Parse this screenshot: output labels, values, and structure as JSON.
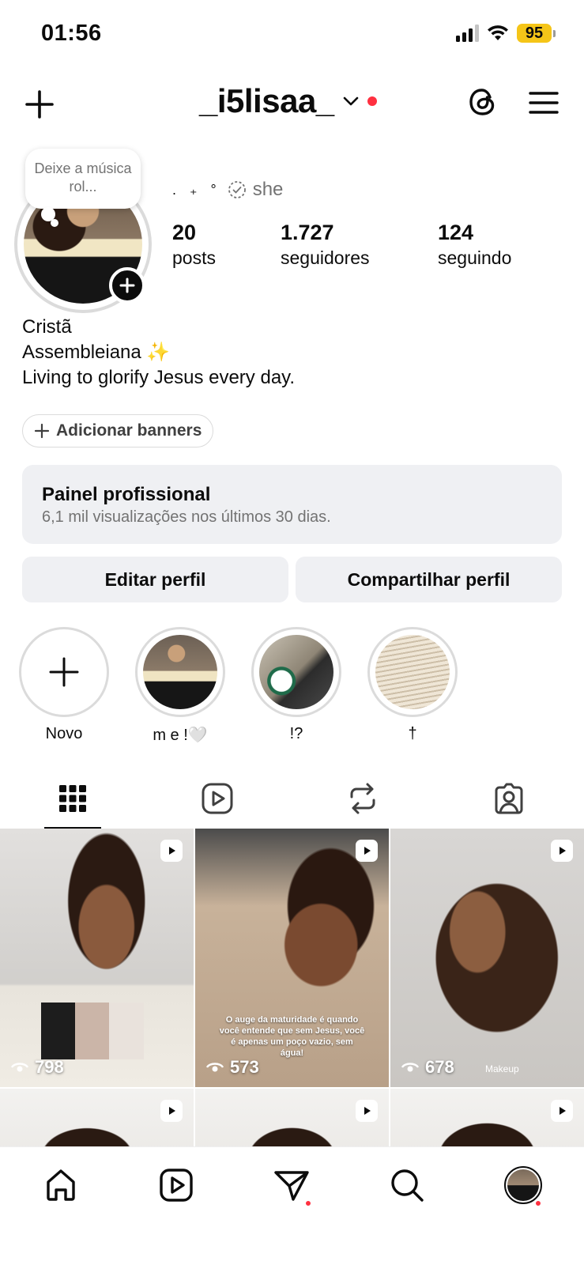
{
  "status_bar": {
    "time": "01:56",
    "battery": "95"
  },
  "header": {
    "username": "_i5lisaa_"
  },
  "profile": {
    "note": "Deixe a música rol...",
    "pronoun_prefix": ". ₊ °",
    "pronouns": "she",
    "stats": [
      {
        "value": "20",
        "label": "posts"
      },
      {
        "value": "1.727",
        "label": "seguidores"
      },
      {
        "value": "124",
        "label": "seguindo"
      }
    ],
    "bio": [
      "Cristã",
      "Assembleiana ✨",
      "Living to glorify Jesus every day."
    ],
    "add_banners": "Adicionar banners"
  },
  "professional_panel": {
    "title": "Painel profissional",
    "subtitle": "6,1 mil visualizações nos últimos 30 dias."
  },
  "actions": {
    "edit": "Editar perfil",
    "share": "Compartilhar perfil"
  },
  "highlights": [
    {
      "label": "Novo"
    },
    {
      "label": "m e !🤍"
    },
    {
      "label": "!?"
    },
    {
      "label": "†"
    }
  ],
  "posts": [
    {
      "views": "798",
      "caption": "",
      "tag": ""
    },
    {
      "views": "573",
      "caption": "O auge da maturidade é quando você entende que sem Jesus, você é apenas um poço vazio, sem água!",
      "tag": ""
    },
    {
      "views": "678",
      "caption": "",
      "tag": "Makeup"
    }
  ],
  "colors": {
    "notification": "#ff3040",
    "battery": "#f5c518",
    "panel": "#eff0f3"
  }
}
